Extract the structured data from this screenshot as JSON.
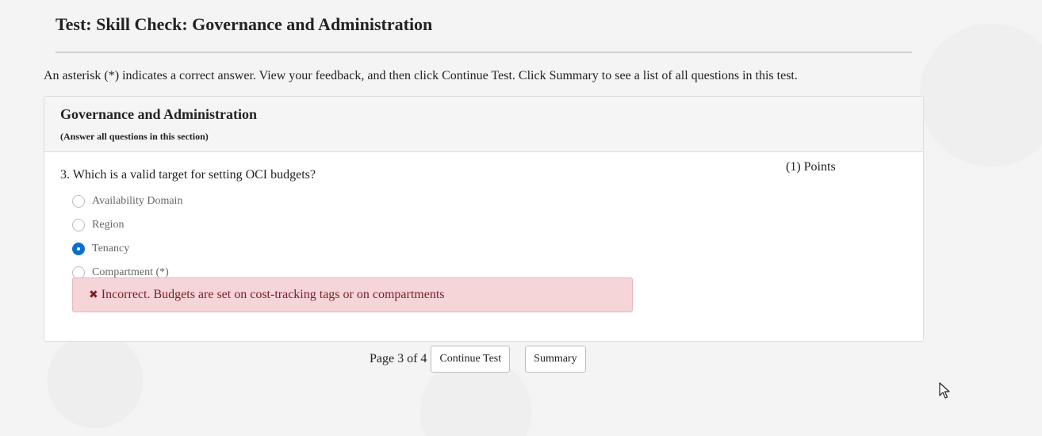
{
  "page": {
    "title": "Test: Skill Check: Governance and Administration",
    "instructions": "An asterisk (*) indicates a correct answer. View your feedback, and then click Continue Test. Click Summary to see a list of all questions in this test."
  },
  "section": {
    "title": "Governance and Administration",
    "note": "(Answer all questions in this section)"
  },
  "question": {
    "text": "3. Which is a valid target for setting OCI budgets?",
    "points": "(1) Points",
    "options": [
      {
        "label": "Availability Domain",
        "selected": false
      },
      {
        "label": "Region",
        "selected": false
      },
      {
        "label": "Tenancy",
        "selected": true
      },
      {
        "label": "Compartment (*)",
        "selected": false
      }
    ],
    "feedback": "Incorrect. Budgets are set on cost-tracking tags or on compartments",
    "feedback_icon": "x-icon"
  },
  "pager": {
    "label": "Page 3 of 4",
    "continue_label": "Continue Test",
    "summary_label": "Summary"
  },
  "colors": {
    "accent": "#0a6fd1",
    "error_bg": "#f5d5d8",
    "error_text": "#7a2128"
  }
}
